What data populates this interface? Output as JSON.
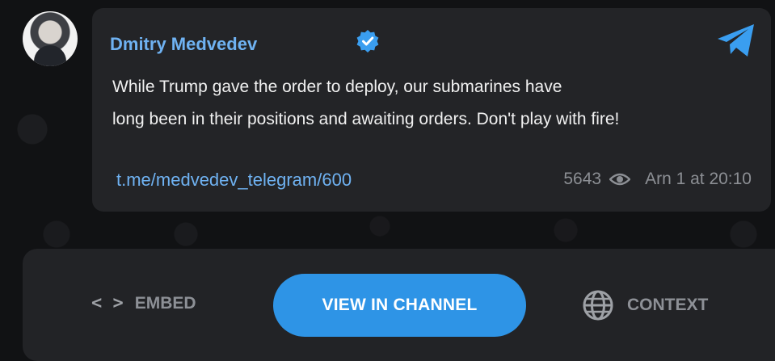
{
  "post": {
    "author": "Dmitry Medvedev",
    "text_lines": [
      "While Trump gave the order to deploy, our submarines have",
      "long been in their positions and awaiting orders. Don't play with fire!"
    ],
    "link": "t.me/medvedev_telegram/600",
    "views": "5643",
    "timestamp": "Arn 1 at 20:10"
  },
  "actions": {
    "embed_label": "EMBED",
    "embed_icon": "< >",
    "view_label": "VIEW IN CHANNEL",
    "context_label": "CONTEXT"
  },
  "icons": {
    "verified": "verified-badge-icon",
    "telegram": "telegram-logo-icon",
    "views": "eye-icon",
    "embed": "code-brackets-icon",
    "context": "globe-icon"
  },
  "colors": {
    "accent": "#2e94e6",
    "link": "#6fb2f2",
    "card_bg": "#232427",
    "page_bg": "#111214"
  }
}
